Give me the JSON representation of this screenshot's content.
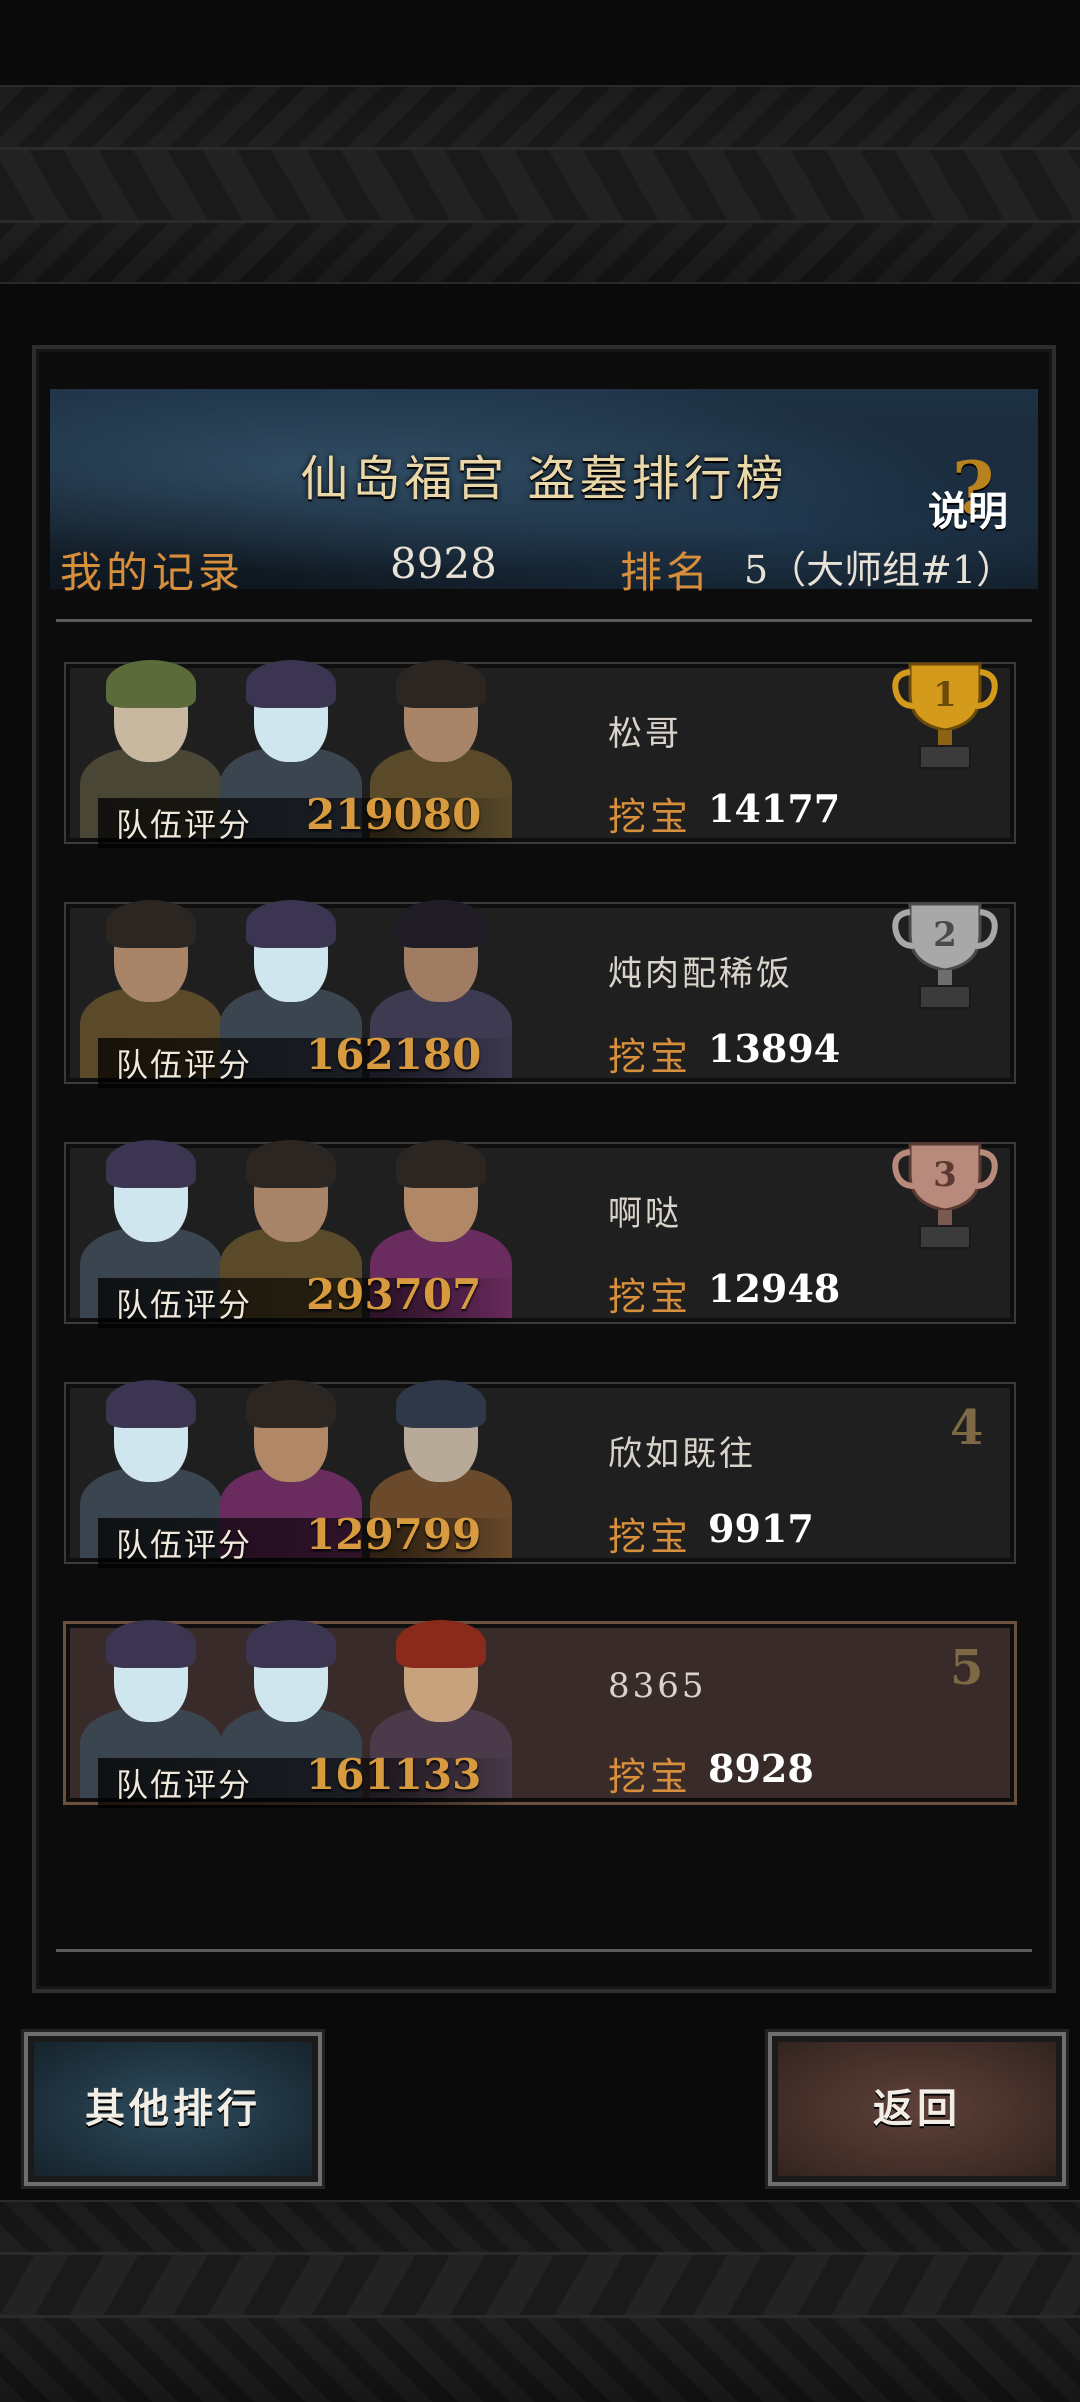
{
  "header": {
    "title": "仙岛福宫 盗墓排行榜",
    "help_label": "说明",
    "help_glyph": "?",
    "record_label": "我的记录",
    "record_value": "8928",
    "rank_label": "排名",
    "rank_value": "5（大师组#1）"
  },
  "entries": [
    {
      "rank": "1",
      "name": "松哥",
      "score_label": "队伍评分",
      "score": "219080",
      "dig_label": "挖宝",
      "dig": "14177",
      "trophy": "gold"
    },
    {
      "rank": "2",
      "name": "炖肉配稀饭",
      "score_label": "队伍评分",
      "score": "162180",
      "dig_label": "挖宝",
      "dig": "13894",
      "trophy": "silver"
    },
    {
      "rank": "3",
      "name": "啊哒",
      "score_label": "队伍评分",
      "score": "293707",
      "dig_label": "挖宝",
      "dig": "12948",
      "trophy": "bronze"
    },
    {
      "rank": "4",
      "name": "欣如既往",
      "score_label": "队伍评分",
      "score": "129799",
      "dig_label": "挖宝",
      "dig": "9917",
      "trophy": ""
    },
    {
      "rank": "5",
      "name": "8365",
      "score_label": "队伍评分",
      "score": "161133",
      "dig_label": "挖宝",
      "dig": "8928",
      "trophy": ""
    }
  ],
  "buttons": {
    "other_rankings": "其他排行",
    "back": "返回"
  },
  "colors": {
    "accent_orange": "#d88f3c",
    "score_gold": "#d89a3e",
    "gold": "#d49a1c",
    "silver": "#a8a8a8",
    "bronze": "#b88a7c"
  }
}
